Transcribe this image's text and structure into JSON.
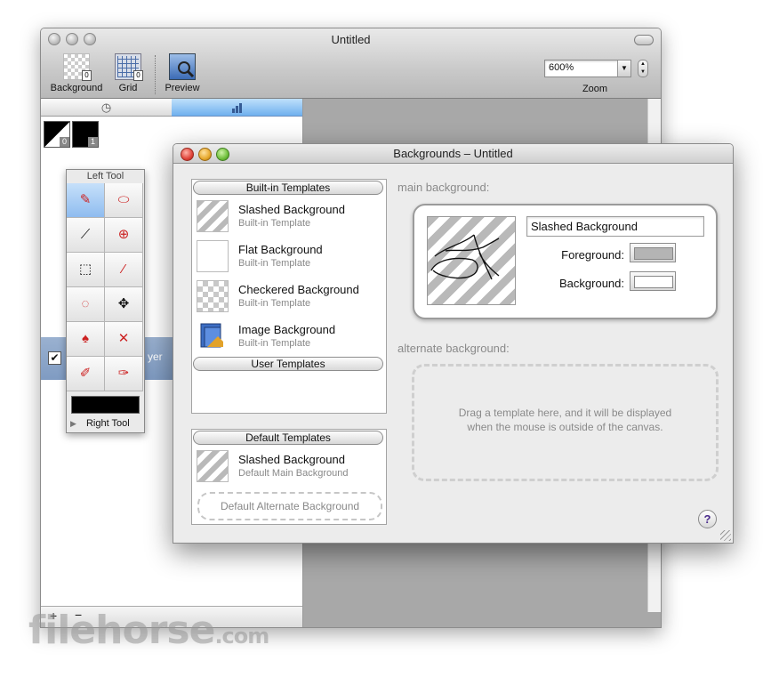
{
  "main_window": {
    "title": "Untitled",
    "toolbar": {
      "background_label": "Background",
      "grid_label": "Grid",
      "preview_label": "Preview",
      "zoom_value": "600%",
      "zoom_label": "Zoom"
    },
    "panel": {
      "swatch_0_badge": "0",
      "swatch_1_badge": "1",
      "layer_name_visible": "yer",
      "add_button": "+",
      "remove_button": "−"
    }
  },
  "tool_palette": {
    "title": "Left Tool",
    "right_tool_label": "Right Tool",
    "tools": [
      "pencil-icon",
      "eraser-icon",
      "eyedropper-icon",
      "zoom-icon",
      "selection-icon",
      "magic-wand-icon",
      "lasso-icon",
      "move-icon",
      "paint-bucket-icon",
      "line-icon",
      "brush-icon",
      "eraser-brush-icon"
    ]
  },
  "backgrounds_window": {
    "title": "Backgrounds – Untitled",
    "builtin_header": "Built-in Templates",
    "builtin_templates": [
      {
        "name": "Slashed Background",
        "subtitle": "Built-in Template",
        "thumb": "slash"
      },
      {
        "name": "Flat Background",
        "subtitle": "Built-in Template",
        "thumb": "flat"
      },
      {
        "name": "Checkered Background",
        "subtitle": "Built-in Template",
        "thumb": "check"
      },
      {
        "name": "Image Background",
        "subtitle": "Built-in Template",
        "thumb": "image"
      }
    ],
    "user_header": "User Templates",
    "default_header": "Default Templates",
    "default_main": {
      "name": "Slashed Background",
      "subtitle": "Default Main Background"
    },
    "default_alt_placeholder": "Default Alternate Background",
    "main_bg_label": "main background:",
    "main_bg_name": "Slashed Background",
    "foreground_label": "Foreground:",
    "foreground_color": "#b4b4b4",
    "background_label": "Background:",
    "background_color": "#ffffff",
    "alt_bg_label": "alternate background:",
    "alt_drop_line1": "Drag a template here, and it will be displayed",
    "alt_drop_line2": "when the mouse is outside of the canvas.",
    "help": "?"
  },
  "watermark": {
    "main": "filehorse",
    "suffix": ".com"
  }
}
